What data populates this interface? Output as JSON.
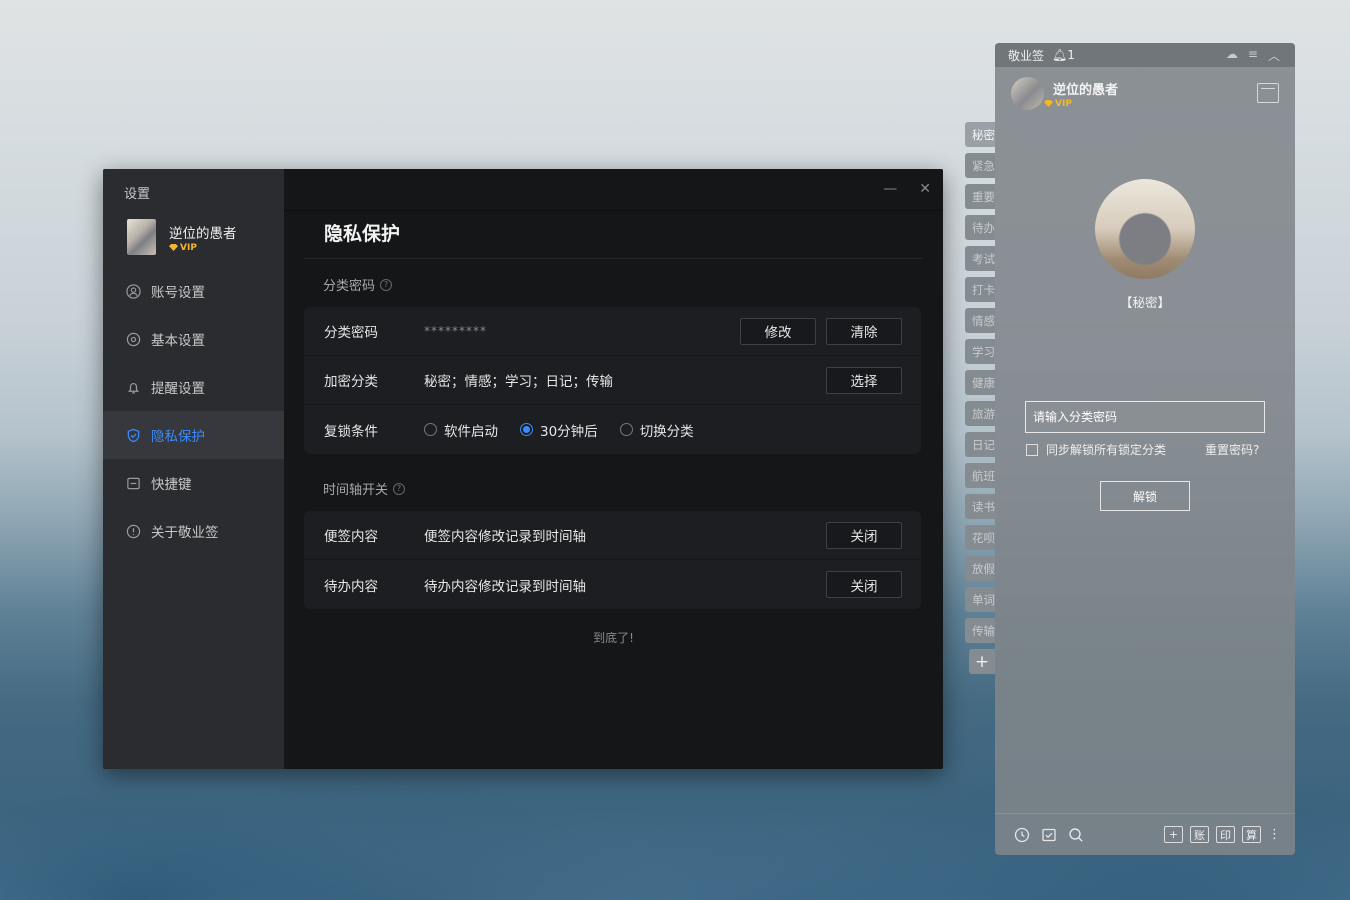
{
  "settings": {
    "window_title": "设置",
    "user": {
      "name": "逆位的愚者",
      "vip": "VIP"
    },
    "nav": [
      {
        "label": "账号设置",
        "icon": "user-icon"
      },
      {
        "label": "基本设置",
        "icon": "gear-icon"
      },
      {
        "label": "提醒设置",
        "icon": "bell-icon"
      },
      {
        "label": "隐私保护",
        "icon": "shield-icon",
        "active": true
      },
      {
        "label": "快捷键",
        "icon": "keyboard-icon"
      },
      {
        "label": "关于敬业签",
        "icon": "info-icon"
      }
    ],
    "page_title": "隐私保护",
    "section1": {
      "title": "分类密码",
      "rows": [
        {
          "label": "分类密码",
          "value": "*********",
          "buttons": [
            "修改",
            "清除"
          ]
        },
        {
          "label": "加密分类",
          "value": "秘密；情感；学习；日记；传输",
          "buttons": [
            "选择"
          ]
        },
        {
          "label": "复锁条件",
          "options": [
            "软件启动",
            "30分钟后",
            "切换分类"
          ],
          "selected": "30分钟后"
        }
      ]
    },
    "section2": {
      "title": "时间轴开关",
      "rows": [
        {
          "label": "便签内容",
          "value": "便签内容修改记录到时间轴",
          "button": "关闭"
        },
        {
          "label": "待办内容",
          "value": "待办内容修改记录到时间轴",
          "button": "关闭"
        }
      ]
    },
    "end_text": "到底了!"
  },
  "panel": {
    "app_name": "敬业签",
    "notif_count": "1",
    "user": {
      "name": "逆位的愚者",
      "vip": "VIP"
    },
    "tabs": [
      "秘密",
      "紧急",
      "重要",
      "待办",
      "考试",
      "打卡",
      "情感",
      "学习",
      "健康",
      "旅游",
      "日记",
      "航班",
      "读书",
      "花呗",
      "放假",
      "单词",
      "传输"
    ],
    "active_tab": "秘密",
    "add_tab": "+",
    "category_label": "【秘密】",
    "password_placeholder": "请输入分类密码",
    "sync_label": "同步解锁所有锁定分类",
    "reset_label": "重置密码?",
    "unlock_label": "解锁",
    "bottom_right": [
      "+",
      "账",
      "印",
      "算"
    ]
  },
  "colors": {
    "accent": "#3a8bff",
    "vip": "#f5b72a"
  }
}
